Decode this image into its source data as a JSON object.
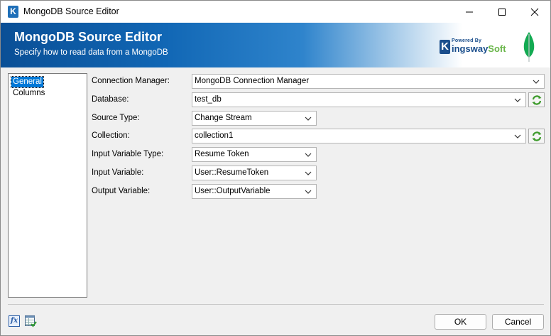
{
  "window": {
    "title": "MongoDB Source Editor",
    "app_icon_letter": "K"
  },
  "banner": {
    "title": "MongoDB Source Editor",
    "subtitle": "Specify how to read data from a MongoDB",
    "logo_powered": "Powered By",
    "logo_letter": "K",
    "logo_name_a": "ingsway",
    "logo_name_b": "Soft"
  },
  "nav": {
    "items": [
      {
        "label": "General",
        "selected": true
      },
      {
        "label": "Columns",
        "selected": false
      }
    ]
  },
  "form": {
    "connection_manager": {
      "label": "Connection Manager:",
      "value": "MongoDB Connection Manager"
    },
    "database": {
      "label": "Database:",
      "value": "test_db"
    },
    "source_type": {
      "label": "Source Type:",
      "value": "Change Stream"
    },
    "collection": {
      "label": "Collection:",
      "value": "collection1"
    },
    "input_variable_type": {
      "label": "Input Variable Type:",
      "value": "Resume Token"
    },
    "input_variable": {
      "label": "Input Variable:",
      "value": "User::ResumeToken"
    },
    "output_variable": {
      "label": "Output Variable:",
      "value": "User::OutputVariable"
    }
  },
  "footer": {
    "fx_icon_text": "fx",
    "ok_label": "OK",
    "cancel_label": "Cancel"
  },
  "colors": {
    "banner_blue": "#1167b5",
    "selection": "#0078d7",
    "kingsway_blue": "#1a4e8c",
    "kingsway_green": "#6ab64a"
  },
  "icons": [
    "app-k-icon",
    "minimize-icon",
    "maximize-icon",
    "close-icon",
    "mongodb-leaf-icon",
    "refresh-icon",
    "chevron-down-icon",
    "expression-fx-icon",
    "grid-properties-icon"
  ]
}
